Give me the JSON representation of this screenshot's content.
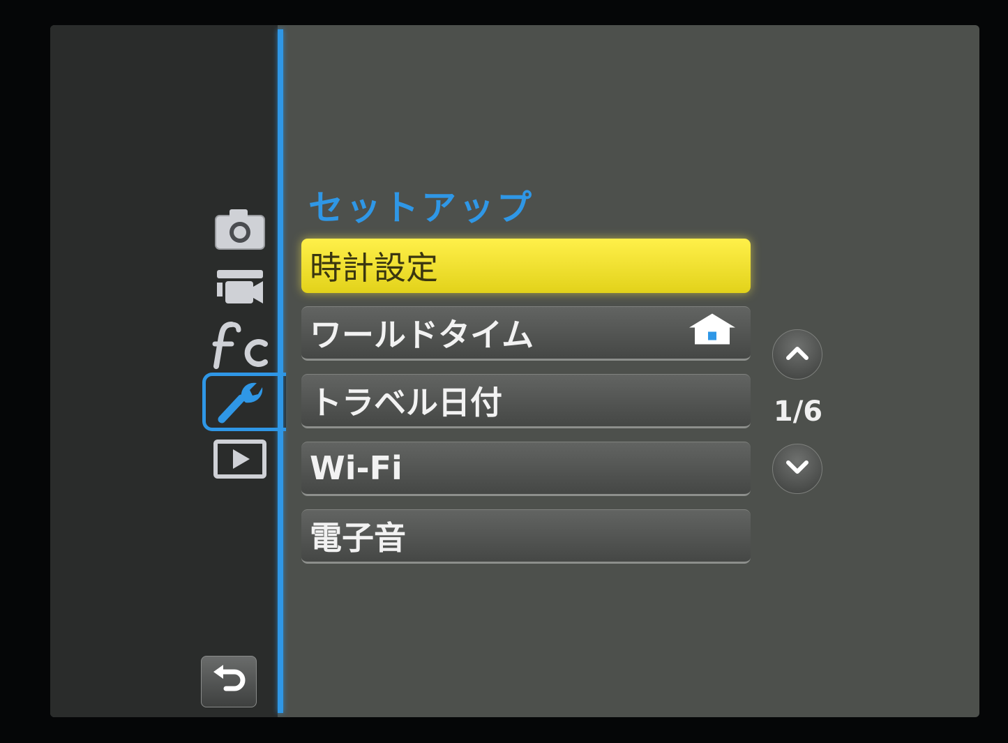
{
  "menu": {
    "title": "セットアップ",
    "items": [
      {
        "label": "時計設定",
        "selected": true
      },
      {
        "label": "ワールドタイム",
        "icon": "home-icon"
      },
      {
        "label": "トラベル日付"
      },
      {
        "label": "Wi-Fi"
      },
      {
        "label": "電子音"
      }
    ]
  },
  "pager": {
    "current": 1,
    "total": 6,
    "label": "1/6"
  },
  "sidebar": {
    "categories": [
      "camera-icon",
      "movie-icon",
      "custom-fc-icon",
      "wrench-icon",
      "playback-icon"
    ],
    "active": "wrench-icon",
    "back": "back-arrow-icon"
  },
  "colors": {
    "accent": "#2f97e6",
    "selected": "#f5e43a",
    "panel": "#4d504c",
    "sidebar": "#2a2c2b"
  }
}
